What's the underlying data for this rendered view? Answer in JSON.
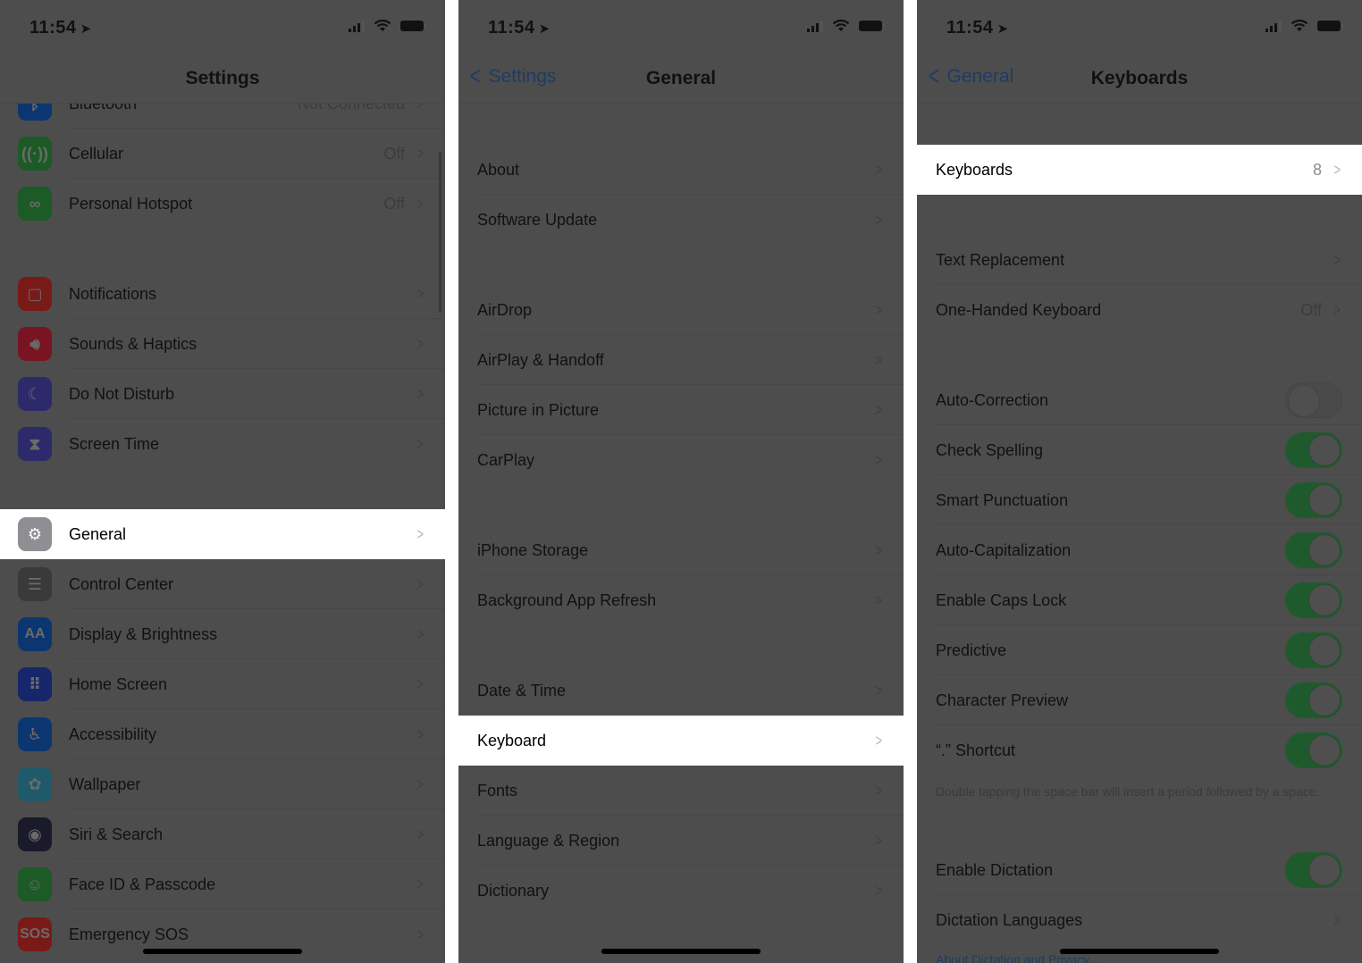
{
  "status_bar": {
    "time": "11:54"
  },
  "colors": {
    "dim_background": "#4d4d4d",
    "highlight": "#ffffff",
    "toggle_on": "#1f5a2c",
    "link": "#1e3c64"
  },
  "settings_panel": {
    "title": "Settings",
    "rows": [
      {
        "label": "Bluetooth",
        "value": "Not Connected",
        "icon": "bluetooth-icon",
        "icon_color": "#0c3670"
      },
      {
        "label": "Cellular",
        "value": "Off",
        "icon": "cellular-antenna-icon",
        "icon_color": "#1c5a26"
      },
      {
        "label": "Personal Hotspot",
        "value": "Off",
        "icon": "hotspot-link-icon",
        "icon_color": "#1c5a26"
      },
      {
        "label": "Notifications",
        "value": "",
        "icon": "notifications-icon",
        "icon_color": "#7a1a18"
      },
      {
        "label": "Sounds & Haptics",
        "value": "",
        "icon": "speaker-icon",
        "icon_color": "#7a1422"
      },
      {
        "label": "Do Not Disturb",
        "value": "",
        "icon": "moon-icon",
        "icon_color": "#2c2a6a"
      },
      {
        "label": "Screen Time",
        "value": "",
        "icon": "hourglass-icon",
        "icon_color": "#2c2a6a"
      },
      {
        "label": "General",
        "value": "",
        "icon": "gear-icon",
        "icon_color": "#8e8e93",
        "highlighted": true
      },
      {
        "label": "Control Center",
        "value": "",
        "icon": "control-center-icon",
        "icon_color": "#3a3a3a"
      },
      {
        "label": "Display & Brightness",
        "value": "",
        "icon": "display-aa-icon",
        "icon_color": "#0c3670",
        "icon_text": "AA"
      },
      {
        "label": "Home Screen",
        "value": "",
        "icon": "home-screen-grid-icon",
        "icon_color": "#15266a"
      },
      {
        "label": "Accessibility",
        "value": "",
        "icon": "accessibility-icon",
        "icon_color": "#0c3670"
      },
      {
        "label": "Wallpaper",
        "value": "",
        "icon": "wallpaper-flower-icon",
        "icon_color": "#1e5a6a"
      },
      {
        "label": "Siri & Search",
        "value": "",
        "icon": "siri-icon",
        "icon_color": "#1a1a2a"
      },
      {
        "label": "Face ID & Passcode",
        "value": "",
        "icon": "face-id-icon",
        "icon_color": "#1c5a26"
      },
      {
        "label": "Emergency SOS",
        "value": "",
        "icon": "sos-icon",
        "icon_color": "#7a1a18",
        "icon_text": "SOS"
      }
    ]
  },
  "general_panel": {
    "back_label": "Settings",
    "title": "General",
    "rows": [
      {
        "label": "About"
      },
      {
        "label": "Software Update"
      },
      {
        "label": "AirDrop"
      },
      {
        "label": "AirPlay & Handoff"
      },
      {
        "label": "Picture in Picture"
      },
      {
        "label": "CarPlay"
      },
      {
        "label": "iPhone Storage"
      },
      {
        "label": "Background App Refresh"
      },
      {
        "label": "Date & Time"
      },
      {
        "label": "Keyboard",
        "highlighted": true
      },
      {
        "label": "Fonts"
      },
      {
        "label": "Language & Region"
      },
      {
        "label": "Dictionary"
      }
    ]
  },
  "keyboards_panel": {
    "back_label": "General",
    "title": "Keyboards",
    "keyboards_row": {
      "label": "Keyboards",
      "value": "8"
    },
    "text_replacement": {
      "label": "Text Replacement"
    },
    "one_handed": {
      "label": "One-Handed Keyboard",
      "value": "Off"
    },
    "toggles": [
      {
        "label": "Auto-Correction",
        "on": false
      },
      {
        "label": "Check Spelling",
        "on": true
      },
      {
        "label": "Smart Punctuation",
        "on": true
      },
      {
        "label": "Auto-Capitalization",
        "on": true
      },
      {
        "label": "Enable Caps Lock",
        "on": true
      },
      {
        "label": "Predictive",
        "on": true
      },
      {
        "label": "Character Preview",
        "on": true
      },
      {
        "label": "“.” Shortcut",
        "on": true
      }
    ],
    "shortcut_footnote": "Double tapping the space bar will insert a period followed by a space.",
    "enable_dictation": {
      "label": "Enable Dictation",
      "on": true
    },
    "dictation_languages": {
      "label": "Dictation Languages"
    },
    "privacy_link": "About Dictation and Privacy…"
  }
}
